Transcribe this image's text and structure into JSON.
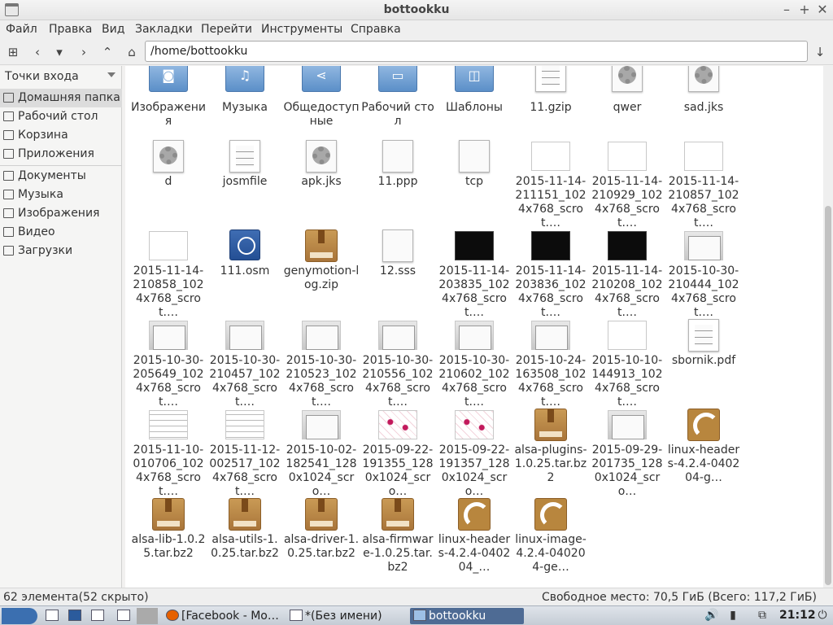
{
  "window": {
    "title": "bottookku"
  },
  "menu": [
    "Файл",
    "Правка",
    "Вид",
    "Закладки",
    "Перейти",
    "Инструменты",
    "Справка"
  ],
  "toolbar": {
    "path": "/home/bottookku"
  },
  "sidebar": {
    "combo_label": "Точки входа",
    "places": [
      "Домашняя папка",
      "Рабочий стол",
      "Корзина",
      "Приложения"
    ],
    "bookmarks": [
      "Документы",
      "Музыка",
      "Изображения",
      "Видео",
      "Загрузки"
    ]
  },
  "files": [
    {
      "label": "Изображения",
      "kind": "folder",
      "icon": "camera-icon"
    },
    {
      "label": "Музыка",
      "kind": "folder",
      "icon": "music-note-icon"
    },
    {
      "label": "Общедоступные",
      "kind": "folder",
      "icon": "share-icon"
    },
    {
      "label": "Рабочий стол",
      "kind": "folder",
      "icon": "desktop-icon"
    },
    {
      "label": "Шаблоны",
      "kind": "folder",
      "icon": "template-icon"
    },
    {
      "label": "11.gzip",
      "kind": "text-file",
      "icon": "text-file-icon"
    },
    {
      "label": "qwer",
      "kind": "exec-file",
      "icon": "gear-icon"
    },
    {
      "label": "sad.jks",
      "kind": "exec-file",
      "icon": "gear-icon"
    },
    {
      "label": "d",
      "kind": "exec-file",
      "icon": "gear-icon"
    },
    {
      "label": "josmfile",
      "kind": "text-file",
      "icon": "text-file-icon"
    },
    {
      "label": "apk.jks",
      "kind": "exec-file",
      "icon": "gear-icon"
    },
    {
      "label": "11.ppp",
      "kind": "blank-file",
      "icon": "blank-file-icon"
    },
    {
      "label": "tcp",
      "kind": "blank-file",
      "icon": "blank-file-icon"
    },
    {
      "label": "2015-11-14-211151_1024x768_scrot.…",
      "kind": "screenshot",
      "icon": "image-thumbnail-icon"
    },
    {
      "label": "2015-11-14-210929_1024x768_scrot.…",
      "kind": "screenshot",
      "icon": "image-thumbnail-icon"
    },
    {
      "label": "2015-11-14-210857_1024x768_scrot.…",
      "kind": "screenshot",
      "icon": "image-thumbnail-icon"
    },
    {
      "label": "2015-11-14-210858_1024x768_scrot.…",
      "kind": "screenshot",
      "icon": "image-thumbnail-icon"
    },
    {
      "label": "111.osm",
      "kind": "globe",
      "icon": "globe-icon"
    },
    {
      "label": "genymotion-log.zip",
      "kind": "package",
      "icon": "package-icon"
    },
    {
      "label": "12.sss",
      "kind": "blank-file",
      "icon": "blank-file-icon"
    },
    {
      "label": "2015-11-14-203835_1024x768_scrot.…",
      "kind": "screenshot-dark",
      "icon": "image-thumbnail-icon"
    },
    {
      "label": "2015-11-14-203836_1024x768_scrot.…",
      "kind": "screenshot-dark",
      "icon": "image-thumbnail-icon"
    },
    {
      "label": "2015-11-14-210208_1024x768_scrot.…",
      "kind": "screenshot-dark",
      "icon": "image-thumbnail-icon"
    },
    {
      "label": "2015-10-30-210444_1024x768_scrot.…",
      "kind": "screenshot-win",
      "icon": "image-thumbnail-icon"
    },
    {
      "label": "2015-10-30-205649_1024x768_scrot.…",
      "kind": "screenshot-win",
      "icon": "image-thumbnail-icon"
    },
    {
      "label": "2015-10-30-210457_1024x768_scrot.…",
      "kind": "screenshot-win",
      "icon": "image-thumbnail-icon"
    },
    {
      "label": "2015-10-30-210523_1024x768_scrot.…",
      "kind": "screenshot-win",
      "icon": "image-thumbnail-icon"
    },
    {
      "label": "2015-10-30-210556_1024x768_scrot.…",
      "kind": "screenshot-win",
      "icon": "image-thumbnail-icon"
    },
    {
      "label": "2015-10-30-210602_1024x768_scrot.…",
      "kind": "screenshot-win",
      "icon": "image-thumbnail-icon"
    },
    {
      "label": "2015-10-24-163508_1024x768_scrot.…",
      "kind": "screenshot-win",
      "icon": "image-thumbnail-icon"
    },
    {
      "label": "2015-10-10-144913_1024x768_scrot.…",
      "kind": "screenshot",
      "icon": "image-thumbnail-icon"
    },
    {
      "label": "sbornik.pdf",
      "kind": "pdf",
      "icon": "pdf-thumbnail-icon"
    },
    {
      "label": "2015-11-10-010706_1024x768_scrot.…",
      "kind": "screenshot-text",
      "icon": "image-thumbnail-icon"
    },
    {
      "label": "2015-11-12-002517_1024x768_scrot.…",
      "kind": "screenshot-text",
      "icon": "image-thumbnail-icon"
    },
    {
      "label": "2015-10-02-182541_1280x1024_scro…",
      "kind": "screenshot-win",
      "icon": "image-thumbnail-icon"
    },
    {
      "label": "2015-09-22-191355_1280x1024_scro…",
      "kind": "screenshot-diag",
      "icon": "image-thumbnail-icon"
    },
    {
      "label": "2015-09-22-191357_1280x1024_scro…",
      "kind": "screenshot-diag",
      "icon": "image-thumbnail-icon"
    },
    {
      "label": "alsa-plugins-1.0.25.tar.bz2",
      "kind": "package",
      "icon": "package-icon"
    },
    {
      "label": "2015-09-29-201735_1280x1024_scro…",
      "kind": "screenshot-win",
      "icon": "image-thumbnail-icon"
    },
    {
      "label": "linux-headers-4.2.4-040204-g…",
      "kind": "deb",
      "icon": "deb-package-icon"
    },
    {
      "label": "alsa-lib-1.0.25.tar.bz2",
      "kind": "package",
      "icon": "package-icon"
    },
    {
      "label": "alsa-utils-1.0.25.tar.bz2",
      "kind": "package",
      "icon": "package-icon"
    },
    {
      "label": "alsa-driver-1.0.25.tar.bz2",
      "kind": "package",
      "icon": "package-icon"
    },
    {
      "label": "alsa-firmware-1.0.25.tar.bz2",
      "kind": "package",
      "icon": "package-icon"
    },
    {
      "label": "linux-headers-4.2.4-040204_…",
      "kind": "deb",
      "icon": "deb-package-icon"
    },
    {
      "label": "linux-image-4.2.4-040204-ge…",
      "kind": "deb",
      "icon": "deb-package-icon"
    }
  ],
  "status": {
    "count": "62 элемента(52 скрыто)",
    "free_space": "Свободное место: 70,5 ГиБ (Всего: 117,2 ГиБ)"
  },
  "taskbar": {
    "tasks": [
      "[Facebook - Mo…",
      "*(Без имени)",
      "bottookku"
    ],
    "clock": "21:12"
  },
  "colors": {
    "accent": "#4e6b94",
    "folder": "#5b8fc8",
    "selection": "#dcdcdc"
  }
}
